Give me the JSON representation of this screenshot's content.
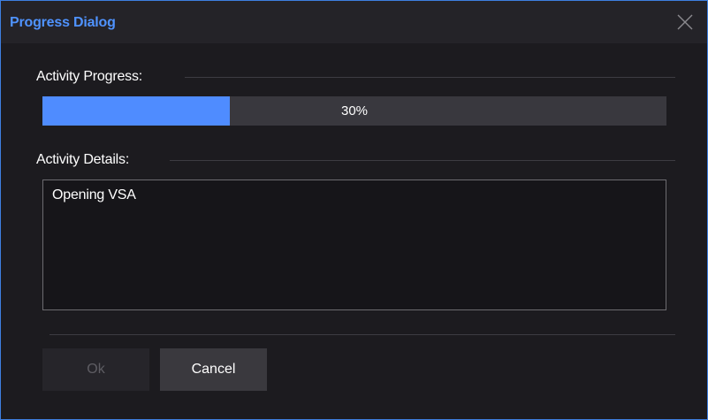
{
  "dialog": {
    "title": "Progress Dialog"
  },
  "progress": {
    "label": "Activity Progress:",
    "percent": 30,
    "text": "30%"
  },
  "details": {
    "label": "Activity Details:",
    "text": "Opening VSA"
  },
  "buttons": {
    "ok_label": "Ok",
    "ok_enabled": false,
    "cancel_label": "Cancel"
  },
  "icons": {
    "close": "close-icon"
  },
  "colors": {
    "accent": "#4f8cff",
    "title": "#4f93ff",
    "background": "#1c1b1f",
    "border": "#3e7fe0"
  }
}
